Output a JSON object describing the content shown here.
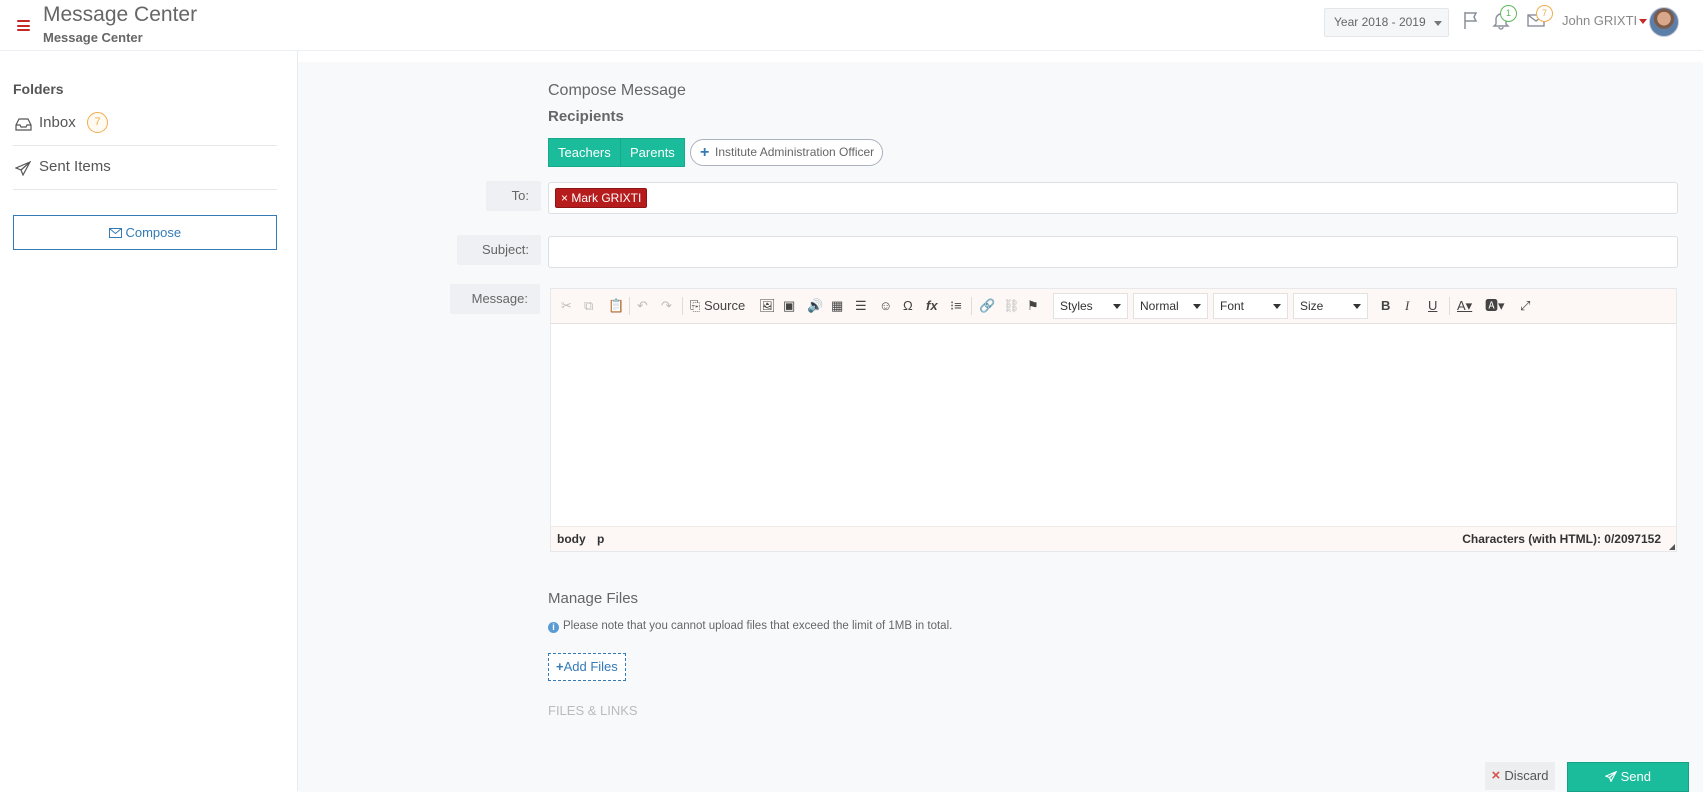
{
  "header": {
    "title": "Message Center",
    "subtitle": "Message Center",
    "year_select": "Year 2018 - 2019",
    "notifications_count": "1",
    "messages_count": "7",
    "user_name": "John GRIXTI"
  },
  "sidebar": {
    "heading": "Folders",
    "items": [
      {
        "label": "Inbox",
        "badge": "7"
      },
      {
        "label": "Sent Items"
      }
    ],
    "compose_label": "Compose"
  },
  "compose": {
    "heading": "Compose Message",
    "recipients_heading": "Recipients",
    "recipient_groups": [
      "Teachers",
      "Parents"
    ],
    "add_group_label": "Institute Administration Officer",
    "to_label": "To:",
    "to_tags": [
      "Mark GRIXTI"
    ],
    "subject_label": "Subject:",
    "subject_value": "",
    "message_label": "Message:"
  },
  "editor": {
    "source_label": "Source",
    "styles_label": "Styles",
    "format_label": "Normal",
    "font_label": "Font",
    "size_label": "Size",
    "path_items": [
      "body",
      "p"
    ],
    "char_count": "Characters (with HTML): 0/2097152"
  },
  "files": {
    "heading": "Manage Files",
    "note": "Please note that you cannot upload files that exceed the limit of 1MB in total.",
    "add_label": "Add Files",
    "files_links_heading": "FILES & LINKS"
  },
  "actions": {
    "discard_label": "Discard",
    "send_label": "Send"
  },
  "colors": {
    "accent": "#1abc9c",
    "tag": "#b71c1c",
    "link": "#337ab7",
    "badge": "#f0ad4e"
  }
}
